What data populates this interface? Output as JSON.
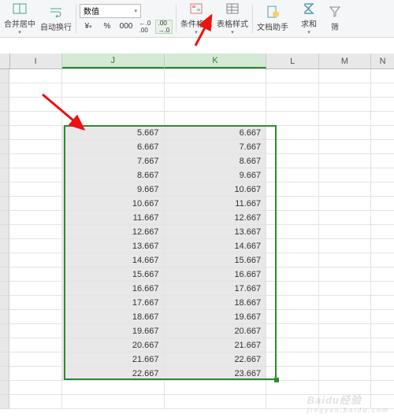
{
  "ribbon": {
    "merge_center": "合并居中",
    "wrap_text": "自动换行",
    "number_format_label": "数值",
    "cond_format": "条件格式",
    "table_style": "表格样式",
    "doc_helper": "文档助手",
    "sum": "求和",
    "filter": "筛"
  },
  "icons": {
    "currency": "¥",
    "percent": "%",
    "thousands": "000",
    "dec_inc": ".00",
    "dec_dec": ".00"
  },
  "columns": [
    "I",
    "J",
    "K",
    "L",
    "M",
    "N"
  ],
  "selected_cols": [
    "J",
    "K"
  ],
  "chart_data": {
    "type": "table",
    "columns": [
      "J",
      "K"
    ],
    "rows": [
      {
        "J": "5.667",
        "K": "6.667"
      },
      {
        "J": "6.667",
        "K": "7.667"
      },
      {
        "J": "7.667",
        "K": "8.667"
      },
      {
        "J": "8.667",
        "K": "9.667"
      },
      {
        "J": "9.667",
        "K": "10.667"
      },
      {
        "J": "10.667",
        "K": "11.667"
      },
      {
        "J": "11.667",
        "K": "12.667"
      },
      {
        "J": "12.667",
        "K": "13.667"
      },
      {
        "J": "13.667",
        "K": "14.667"
      },
      {
        "J": "14.667",
        "K": "15.667"
      },
      {
        "J": "15.667",
        "K": "16.667"
      },
      {
        "J": "16.667",
        "K": "17.667"
      },
      {
        "J": "17.667",
        "K": "18.667"
      },
      {
        "J": "18.667",
        "K": "19.667"
      },
      {
        "J": "19.667",
        "K": "20.667"
      },
      {
        "J": "20.667",
        "K": "21.667"
      },
      {
        "J": "21.667",
        "K": "22.667"
      },
      {
        "J": "22.667",
        "K": "23.667"
      }
    ]
  },
  "watermark": {
    "brand": "Baidu经验",
    "sub": "jingyan.baidu.com"
  }
}
